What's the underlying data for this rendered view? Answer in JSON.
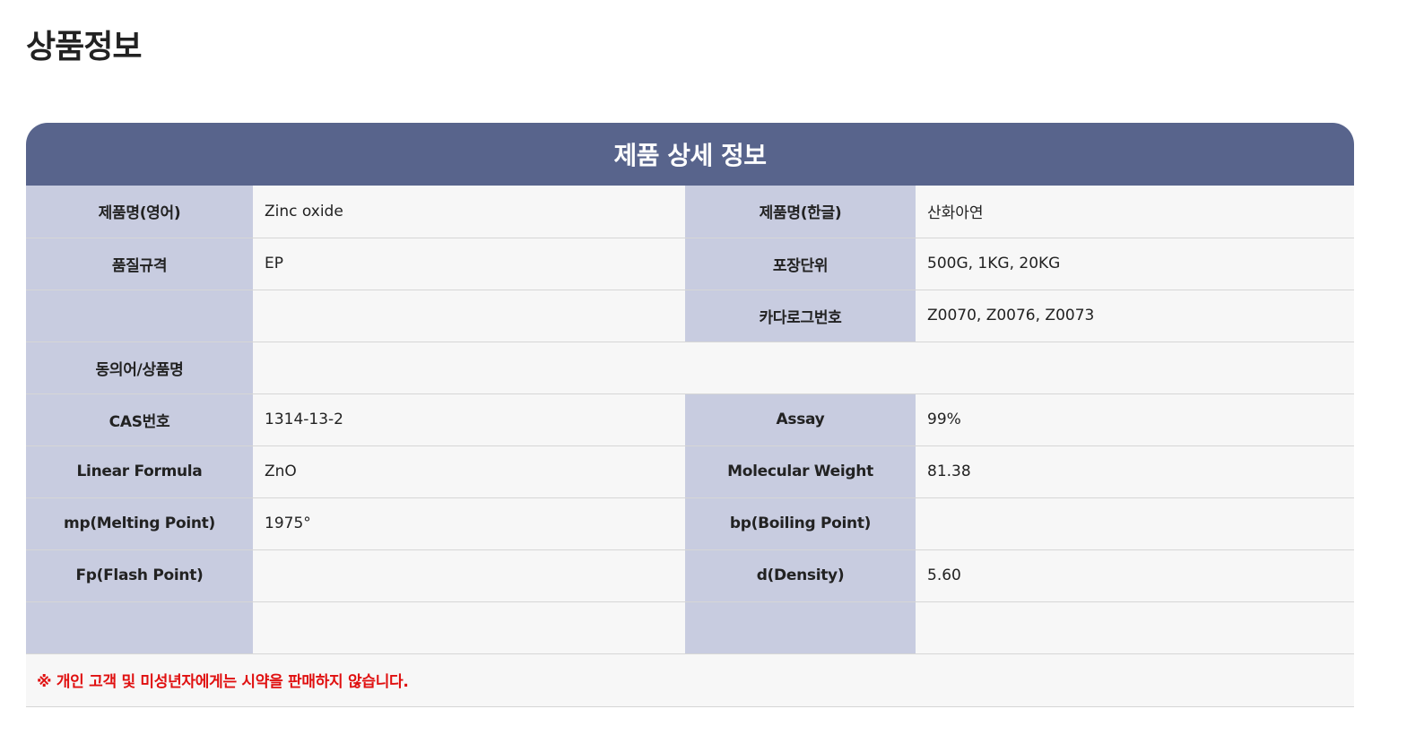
{
  "page": {
    "title": "상품정보"
  },
  "card": {
    "header": "제품 상세 정보",
    "rows": {
      "r1": {
        "l1": "제품명(영어)",
        "v1": "Zinc oxide",
        "l2": "제품명(한글)",
        "v2": "산화아연"
      },
      "r2": {
        "l1": "품질규격",
        "v1": "EP",
        "l2": "포장단위",
        "v2": "500G, 1KG, 20KG"
      },
      "r3": {
        "l1": "",
        "v1": "",
        "l2": "카다로그번호",
        "v2": "Z0070, Z0076, Z0073"
      },
      "r4": {
        "l1": "동의어/상품명",
        "v1": ""
      },
      "r5": {
        "l1": "CAS번호",
        "v1": "1314-13-2",
        "l2": "Assay",
        "v2": "99%"
      },
      "r6": {
        "l1": "Linear Formula",
        "v1": "ZnO",
        "l2": "Molecular Weight",
        "v2": "81.38"
      },
      "r7": {
        "l1": "mp(Melting Point)",
        "v1": "1975°",
        "l2": "bp(Boiling Point)",
        "v2": ""
      },
      "r8": {
        "l1": "Fp(Flash Point)",
        "v1": "",
        "l2": "d(Density)",
        "v2": "5.60"
      },
      "r9": {
        "l1": "",
        "v1": "",
        "l2": "",
        "v2": ""
      }
    },
    "notice": "※ 개인 고객 및 미성년자에게는 시약을 판매하지 않습니다."
  },
  "colors": {
    "header_bg": "#58648c",
    "label_bg": "#c8cce0",
    "value_bg": "#f7f7f7",
    "notice_text": "#e01010"
  }
}
